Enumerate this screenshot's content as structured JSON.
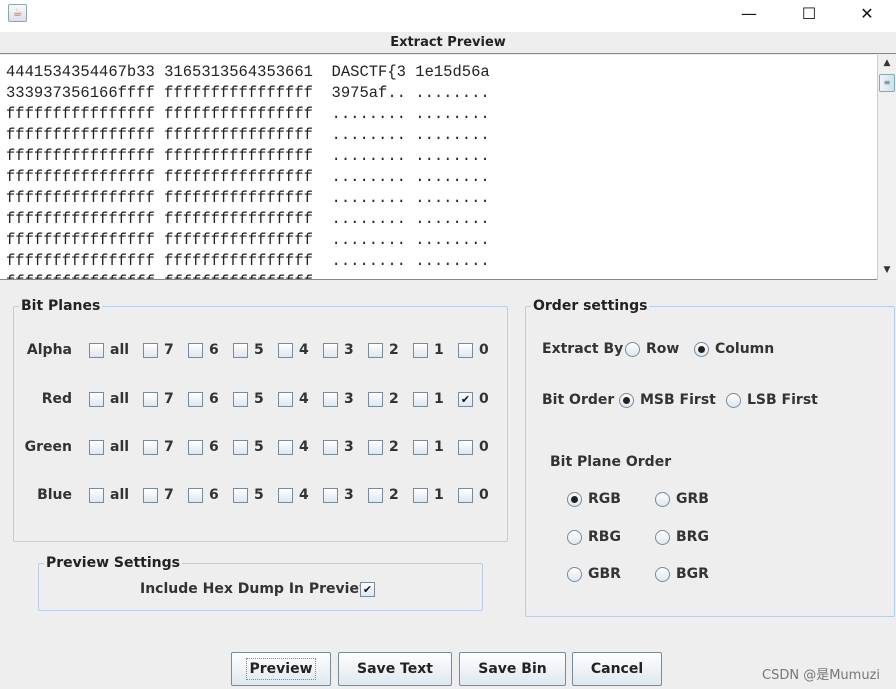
{
  "window": {
    "title_icon": "java-cup-icon",
    "minimize": "—",
    "maximize": "☐",
    "close": "✕"
  },
  "preview": {
    "title": "Extract Preview",
    "lines": [
      "4441534354467b33 3165313564353661  DASCTF{3 1e15d56a",
      "333937356166ffff ffffffffffffffff  3975af.. ........",
      "ffffffffffffffff ffffffffffffffff  ........ ........",
      "ffffffffffffffff ffffffffffffffff  ........ ........",
      "ffffffffffffffff ffffffffffffffff  ........ ........",
      "ffffffffffffffff ffffffffffffffff  ........ ........",
      "ffffffffffffffff ffffffffffffffff  ........ ........",
      "ffffffffffffffff ffffffffffffffff  ........ ........",
      "ffffffffffffffff ffffffffffffffff  ........ ........",
      "ffffffffffffffff ffffffffffffffff  ........ ........",
      "ffffffffffffffff ffffffffffffffff  ........ ........"
    ]
  },
  "bit_planes": {
    "title": "Bit Planes",
    "bits": [
      "all",
      "7",
      "6",
      "5",
      "4",
      "3",
      "2",
      "1",
      "0"
    ],
    "channels": [
      {
        "name": "Alpha",
        "checked": []
      },
      {
        "name": "Red",
        "checked": [
          "0"
        ]
      },
      {
        "name": "Green",
        "checked": []
      },
      {
        "name": "Blue",
        "checked": []
      }
    ]
  },
  "preview_settings": {
    "title": "Preview Settings",
    "hex_dump_label": "Include Hex Dump In Preview",
    "hex_dump_checked": true
  },
  "order": {
    "title": "Order settings",
    "extract_by_label": "Extract By",
    "extract_by": [
      {
        "label": "Row",
        "selected": false
      },
      {
        "label": "Column",
        "selected": true
      }
    ],
    "bit_order_label": "Bit Order",
    "bit_order": [
      {
        "label": "MSB First",
        "selected": true
      },
      {
        "label": "LSB First",
        "selected": false
      }
    ],
    "plane_order_label": "Bit Plane Order",
    "plane_order": [
      {
        "label": "RGB",
        "selected": true
      },
      {
        "label": "GRB",
        "selected": false
      },
      {
        "label": "RBG",
        "selected": false
      },
      {
        "label": "BRG",
        "selected": false
      },
      {
        "label": "GBR",
        "selected": false
      },
      {
        "label": "BGR",
        "selected": false
      }
    ]
  },
  "buttons": {
    "preview": "Preview",
    "save_text": "Save Text",
    "save_bin": "Save Bin",
    "cancel": "Cancel"
  },
  "watermark": "CSDN @是Mumuzi"
}
